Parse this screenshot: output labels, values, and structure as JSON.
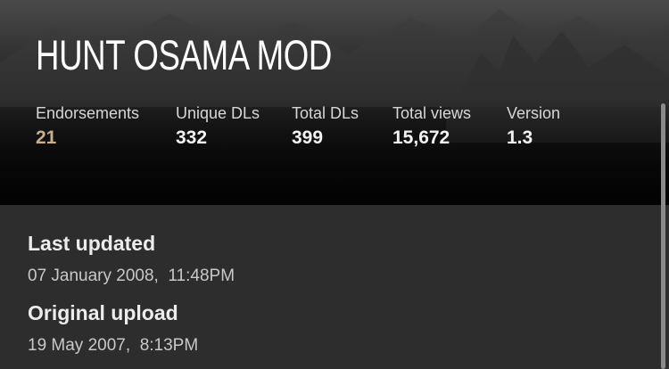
{
  "header": {
    "title": "HUNT OSAMA MOD"
  },
  "stats": [
    {
      "label": "Endorsements",
      "value": "21"
    },
    {
      "label": "Unique DLs",
      "value": "332"
    },
    {
      "label": "Total DLs",
      "value": "399"
    },
    {
      "label": "Total views",
      "value": "15,672"
    },
    {
      "label": "Version",
      "value": "1.3"
    }
  ],
  "details": {
    "last_updated": {
      "label": "Last updated",
      "value": "07 January 2008,  11:48PM"
    },
    "original_upload": {
      "label": "Original upload",
      "value": "19 May 2007,  8:13PM"
    }
  },
  "colors": {
    "background": "#2d2d2d",
    "accent": "#c7b08a",
    "text": "#ffffff"
  }
}
